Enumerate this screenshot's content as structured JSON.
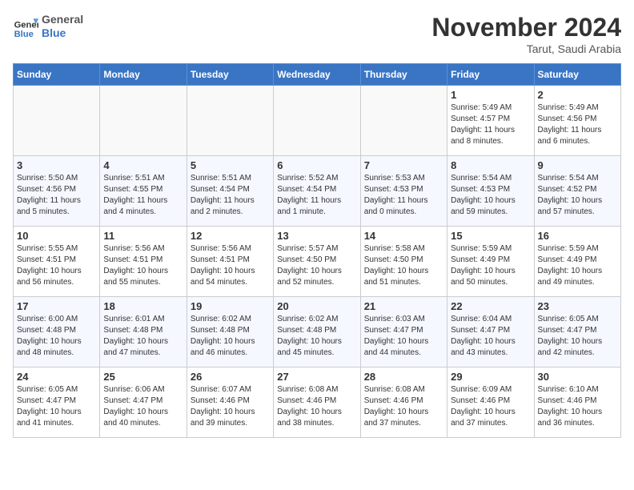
{
  "logo": {
    "line1": "General",
    "line2": "Blue"
  },
  "title": "November 2024",
  "location": "Tarut, Saudi Arabia",
  "days_of_week": [
    "Sunday",
    "Monday",
    "Tuesday",
    "Wednesday",
    "Thursday",
    "Friday",
    "Saturday"
  ],
  "weeks": [
    [
      {
        "day": "",
        "info": ""
      },
      {
        "day": "",
        "info": ""
      },
      {
        "day": "",
        "info": ""
      },
      {
        "day": "",
        "info": ""
      },
      {
        "day": "",
        "info": ""
      },
      {
        "day": "1",
        "info": "Sunrise: 5:49 AM\nSunset: 4:57 PM\nDaylight: 11 hours\nand 8 minutes."
      },
      {
        "day": "2",
        "info": "Sunrise: 5:49 AM\nSunset: 4:56 PM\nDaylight: 11 hours\nand 6 minutes."
      }
    ],
    [
      {
        "day": "3",
        "info": "Sunrise: 5:50 AM\nSunset: 4:56 PM\nDaylight: 11 hours\nand 5 minutes."
      },
      {
        "day": "4",
        "info": "Sunrise: 5:51 AM\nSunset: 4:55 PM\nDaylight: 11 hours\nand 4 minutes."
      },
      {
        "day": "5",
        "info": "Sunrise: 5:51 AM\nSunset: 4:54 PM\nDaylight: 11 hours\nand 2 minutes."
      },
      {
        "day": "6",
        "info": "Sunrise: 5:52 AM\nSunset: 4:54 PM\nDaylight: 11 hours\nand 1 minute."
      },
      {
        "day": "7",
        "info": "Sunrise: 5:53 AM\nSunset: 4:53 PM\nDaylight: 11 hours\nand 0 minutes."
      },
      {
        "day": "8",
        "info": "Sunrise: 5:54 AM\nSunset: 4:53 PM\nDaylight: 10 hours\nand 59 minutes."
      },
      {
        "day": "9",
        "info": "Sunrise: 5:54 AM\nSunset: 4:52 PM\nDaylight: 10 hours\nand 57 minutes."
      }
    ],
    [
      {
        "day": "10",
        "info": "Sunrise: 5:55 AM\nSunset: 4:51 PM\nDaylight: 10 hours\nand 56 minutes."
      },
      {
        "day": "11",
        "info": "Sunrise: 5:56 AM\nSunset: 4:51 PM\nDaylight: 10 hours\nand 55 minutes."
      },
      {
        "day": "12",
        "info": "Sunrise: 5:56 AM\nSunset: 4:51 PM\nDaylight: 10 hours\nand 54 minutes."
      },
      {
        "day": "13",
        "info": "Sunrise: 5:57 AM\nSunset: 4:50 PM\nDaylight: 10 hours\nand 52 minutes."
      },
      {
        "day": "14",
        "info": "Sunrise: 5:58 AM\nSunset: 4:50 PM\nDaylight: 10 hours\nand 51 minutes."
      },
      {
        "day": "15",
        "info": "Sunrise: 5:59 AM\nSunset: 4:49 PM\nDaylight: 10 hours\nand 50 minutes."
      },
      {
        "day": "16",
        "info": "Sunrise: 5:59 AM\nSunset: 4:49 PM\nDaylight: 10 hours\nand 49 minutes."
      }
    ],
    [
      {
        "day": "17",
        "info": "Sunrise: 6:00 AM\nSunset: 4:48 PM\nDaylight: 10 hours\nand 48 minutes."
      },
      {
        "day": "18",
        "info": "Sunrise: 6:01 AM\nSunset: 4:48 PM\nDaylight: 10 hours\nand 47 minutes."
      },
      {
        "day": "19",
        "info": "Sunrise: 6:02 AM\nSunset: 4:48 PM\nDaylight: 10 hours\nand 46 minutes."
      },
      {
        "day": "20",
        "info": "Sunrise: 6:02 AM\nSunset: 4:48 PM\nDaylight: 10 hours\nand 45 minutes."
      },
      {
        "day": "21",
        "info": "Sunrise: 6:03 AM\nSunset: 4:47 PM\nDaylight: 10 hours\nand 44 minutes."
      },
      {
        "day": "22",
        "info": "Sunrise: 6:04 AM\nSunset: 4:47 PM\nDaylight: 10 hours\nand 43 minutes."
      },
      {
        "day": "23",
        "info": "Sunrise: 6:05 AM\nSunset: 4:47 PM\nDaylight: 10 hours\nand 42 minutes."
      }
    ],
    [
      {
        "day": "24",
        "info": "Sunrise: 6:05 AM\nSunset: 4:47 PM\nDaylight: 10 hours\nand 41 minutes."
      },
      {
        "day": "25",
        "info": "Sunrise: 6:06 AM\nSunset: 4:47 PM\nDaylight: 10 hours\nand 40 minutes."
      },
      {
        "day": "26",
        "info": "Sunrise: 6:07 AM\nSunset: 4:46 PM\nDaylight: 10 hours\nand 39 minutes."
      },
      {
        "day": "27",
        "info": "Sunrise: 6:08 AM\nSunset: 4:46 PM\nDaylight: 10 hours\nand 38 minutes."
      },
      {
        "day": "28",
        "info": "Sunrise: 6:08 AM\nSunset: 4:46 PM\nDaylight: 10 hours\nand 37 minutes."
      },
      {
        "day": "29",
        "info": "Sunrise: 6:09 AM\nSunset: 4:46 PM\nDaylight: 10 hours\nand 37 minutes."
      },
      {
        "day": "30",
        "info": "Sunrise: 6:10 AM\nSunset: 4:46 PM\nDaylight: 10 hours\nand 36 minutes."
      }
    ]
  ]
}
